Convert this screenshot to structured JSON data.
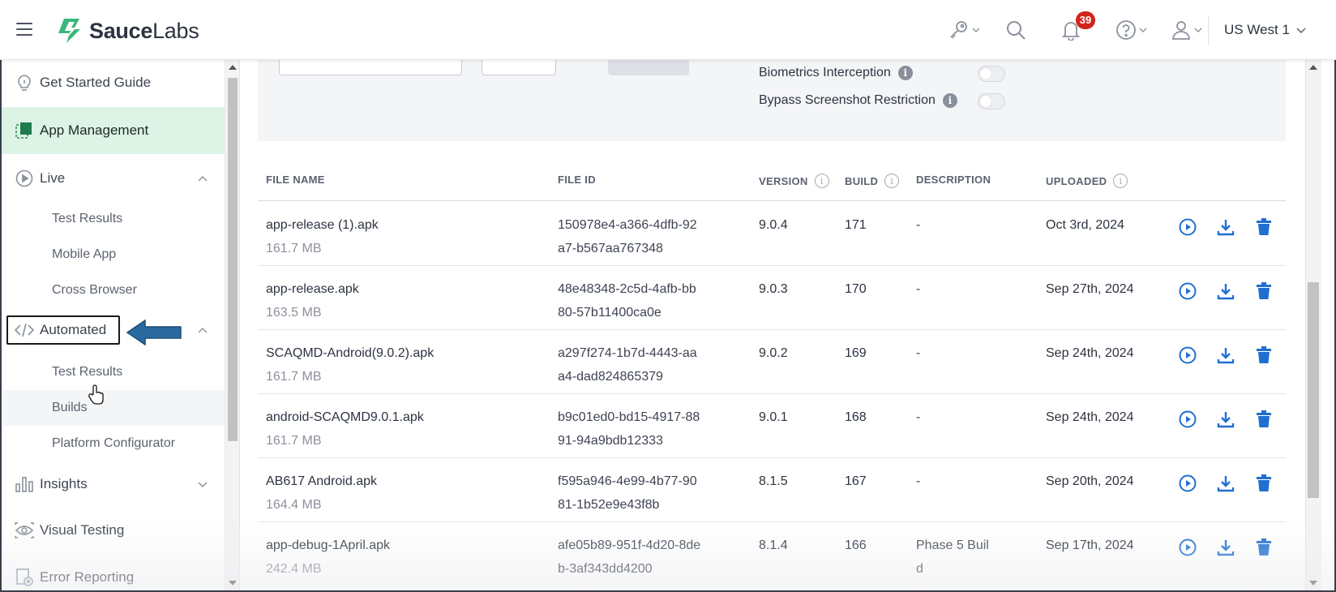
{
  "header": {
    "logo_bold": "Sauce",
    "logo_light": "Labs",
    "notification_count": "39",
    "region": "US West 1",
    "icons": [
      "menu-icon",
      "key-icon",
      "search-icon",
      "bell-icon",
      "help-icon",
      "user-icon",
      "chevron-down-icon"
    ]
  },
  "sidebar": {
    "items": [
      {
        "label": "Get Started Guide",
        "icon": "lightbulb-icon"
      },
      {
        "label": "App Management",
        "icon": "app-management-icon",
        "active": true
      },
      {
        "label": "Live",
        "icon": "play-circle-icon",
        "expanded": true
      },
      {
        "label": "Automated",
        "icon": "code-icon",
        "expanded": true
      },
      {
        "label": "Insights",
        "icon": "bar-chart-icon",
        "expanded": false
      },
      {
        "label": "Visual Testing",
        "icon": "eye-icon"
      },
      {
        "label": "Error Reporting",
        "icon": "error-report-icon"
      }
    ],
    "live_sub": [
      "Test Results",
      "Mobile App",
      "Cross Browser"
    ],
    "automated_sub": [
      "Test Results",
      "Builds",
      "Platform Configurator"
    ]
  },
  "settings": {
    "biometrics_label": "Biometrics Interception",
    "screenshot_label": "Bypass Screenshot Restriction",
    "biometrics_on": false,
    "screenshot_on": false
  },
  "table": {
    "headers": [
      "FILE NAME",
      "FILE ID",
      "VERSION",
      "BUILD",
      "DESCRIPTION",
      "UPLOADED"
    ],
    "rows": [
      {
        "name": "app-release (1).apk",
        "size": "161.7 MB",
        "file_id": "150978e4-a366-4dfb-92a7-b567aa767348",
        "version": "9.0.4",
        "build": "171",
        "description": "-",
        "uploaded": "Oct 3rd, 2024"
      },
      {
        "name": "app-release.apk",
        "size": "163.5 MB",
        "file_id": "48e48348-2c5d-4afb-bb80-57b11400ca0e",
        "version": "9.0.3",
        "build": "170",
        "description": "-",
        "uploaded": "Sep 27th, 2024"
      },
      {
        "name": "SCAQMD-Android(9.0.2).apk",
        "size": "161.7 MB",
        "file_id": "a297f274-1b7d-4443-aaa4-dad824865379",
        "version": "9.0.2",
        "build": "169",
        "description": "-",
        "uploaded": "Sep 24th, 2024"
      },
      {
        "name": "android-SCAQMD9.0.1.apk",
        "size": "161.7 MB",
        "file_id": "b9c01ed0-bd15-4917-8891-94a9bdb12333",
        "version": "9.0.1",
        "build": "168",
        "description": "-",
        "uploaded": "Sep 24th, 2024"
      },
      {
        "name": "AB617 Android.apk",
        "size": "164.4 MB",
        "file_id": "f595a946-4e99-4b77-9081-1b52e9e43f8b",
        "version": "8.1.5",
        "build": "167",
        "description": "-",
        "uploaded": "Sep 20th, 2024"
      },
      {
        "name": "app-debug-1April.apk",
        "size": "242.4 MB",
        "file_id": "afe05b89-951f-4d20-8deb-3af343dd4200",
        "version": "8.1.4",
        "build": "166",
        "description": "Phase 5 Build",
        "uploaded": "Sep 17th, 2024"
      }
    ]
  },
  "colors": {
    "brand_green": "#3ddc84",
    "active_bg": "#dcf3e6",
    "action_blue": "#1f6fd1",
    "badge_red": "#d0241a"
  }
}
